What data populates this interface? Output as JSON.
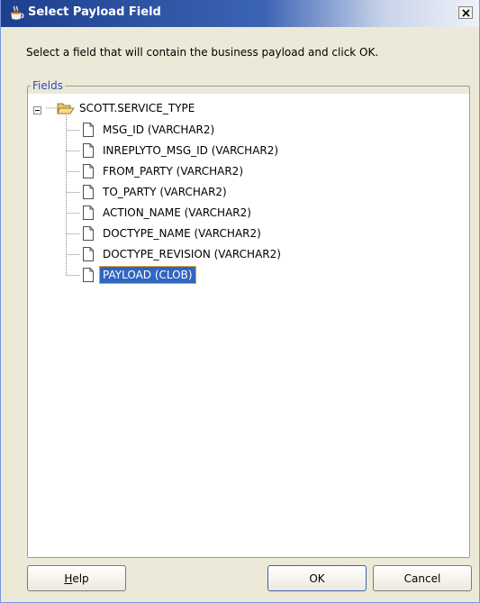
{
  "window": {
    "title": "Select Payload Field",
    "title_icon": "coffee-cup-icon",
    "close_icon": "close-icon"
  },
  "instruction": "Select a field that will contain the business payload and click OK.",
  "fields": {
    "legend": "Fields",
    "root": {
      "label": "SCOTT.SERVICE_TYPE",
      "icon": "folder-open-icon",
      "expanded": true
    },
    "items": [
      {
        "label": "MSG_ID (VARCHAR2)",
        "icon": "file-icon",
        "selected": false
      },
      {
        "label": "INREPLYTO_MSG_ID (VARCHAR2)",
        "icon": "file-icon",
        "selected": false
      },
      {
        "label": "FROM_PARTY (VARCHAR2)",
        "icon": "file-icon",
        "selected": false
      },
      {
        "label": "TO_PARTY (VARCHAR2)",
        "icon": "file-icon",
        "selected": false
      },
      {
        "label": "ACTION_NAME (VARCHAR2)",
        "icon": "file-icon",
        "selected": false
      },
      {
        "label": "DOCTYPE_NAME (VARCHAR2)",
        "icon": "file-icon",
        "selected": false
      },
      {
        "label": "DOCTYPE_REVISION (VARCHAR2)",
        "icon": "file-icon",
        "selected": false
      },
      {
        "label": "PAYLOAD (CLOB)",
        "icon": "file-icon",
        "selected": true
      }
    ]
  },
  "buttons": {
    "help": {
      "mnemonic": "H",
      "rest": "elp"
    },
    "ok": "OK",
    "cancel": "Cancel"
  },
  "colors": {
    "title_bar_start": "#1c3f8f",
    "selection": "#3065c1",
    "legend_text": "#2b4fad"
  }
}
